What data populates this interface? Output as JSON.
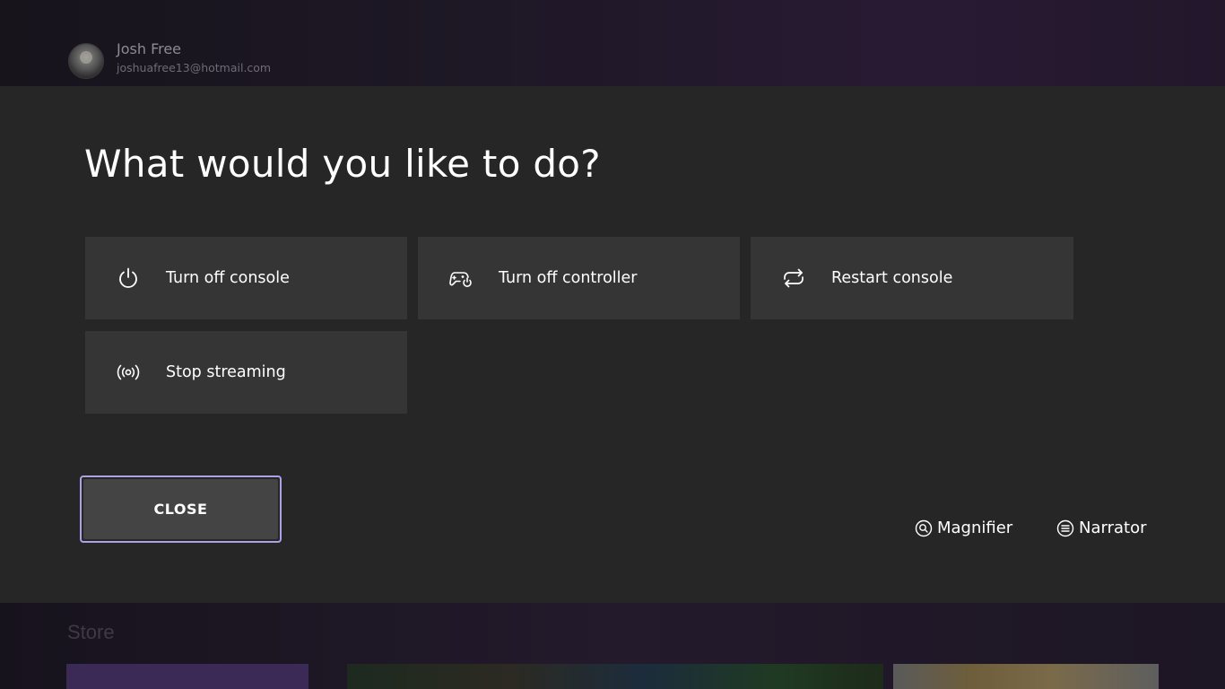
{
  "profile": {
    "name": "Josh Free",
    "email": "joshuafree13@hotmail.com"
  },
  "dialog": {
    "title": "What would you like to do?",
    "options": [
      {
        "label": "Turn off console",
        "icon": "power-icon"
      },
      {
        "label": "Turn off controller",
        "icon": "controller-power-icon"
      },
      {
        "label": "Restart console",
        "icon": "restart-icon"
      },
      {
        "label": "Stop streaming",
        "icon": "streaming-icon"
      }
    ],
    "close_label": "CLOSE",
    "accessibility": {
      "magnifier_label": "Magnifier",
      "narrator_label": "Narrator"
    }
  },
  "background": {
    "section_label": "Store"
  },
  "colors": {
    "dialog_bg": "#262626",
    "option_bg": "#353535",
    "focus_border": "#a9a3e6",
    "text": "#ffffff"
  }
}
